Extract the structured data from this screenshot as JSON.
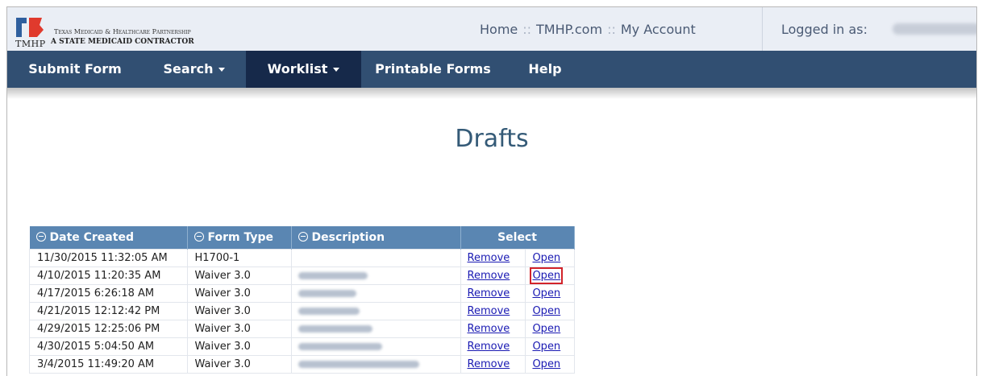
{
  "header": {
    "logo_text_tmhp": "TMHP",
    "logo_line1": "Texas Medicaid & Healthcare Partnership",
    "logo_line2": "A STATE MEDICAID CONTRACTOR",
    "links": [
      "Home",
      "TMHP.com",
      "My Account"
    ],
    "link_separator": "::",
    "logged_in_label": "Logged in as:"
  },
  "nav": {
    "items": [
      {
        "label": "Submit Form",
        "dropdown": false,
        "active": false
      },
      {
        "label": "Search",
        "dropdown": true,
        "active": false
      },
      {
        "label": "Worklist",
        "dropdown": true,
        "active": true
      },
      {
        "label": "Printable Forms",
        "dropdown": false,
        "active": false
      },
      {
        "label": "Help",
        "dropdown": false,
        "active": false
      }
    ]
  },
  "page": {
    "title": "Drafts"
  },
  "table": {
    "columns": [
      "Date Created",
      "Form Type",
      "Description",
      "Select"
    ],
    "remove_label": "Remove",
    "open_label": "Open",
    "rows": [
      {
        "date": "11/30/2015 11:32:05 AM",
        "form_type": "H1700-1"
      },
      {
        "date": "4/10/2015 11:20:35 AM",
        "form_type": "Waiver 3.0"
      },
      {
        "date": "4/17/2015 6:26:18 AM",
        "form_type": "Waiver 3.0"
      },
      {
        "date": "4/21/2015 12:12:42 PM",
        "form_type": "Waiver 3.0"
      },
      {
        "date": "4/29/2015 12:25:06 PM",
        "form_type": "Waiver 3.0"
      },
      {
        "date": "4/30/2015 5:04:50 AM",
        "form_type": "Waiver 3.0"
      },
      {
        "date": "3/4/2015 11:49:20 AM",
        "form_type": "Waiver 3.0"
      }
    ]
  },
  "colors": {
    "nav_bg": "#314f72",
    "nav_active_bg": "#16294a",
    "table_header_bg": "#5a86b2",
    "title_color": "#345a77",
    "highlight": "#d2232a"
  }
}
